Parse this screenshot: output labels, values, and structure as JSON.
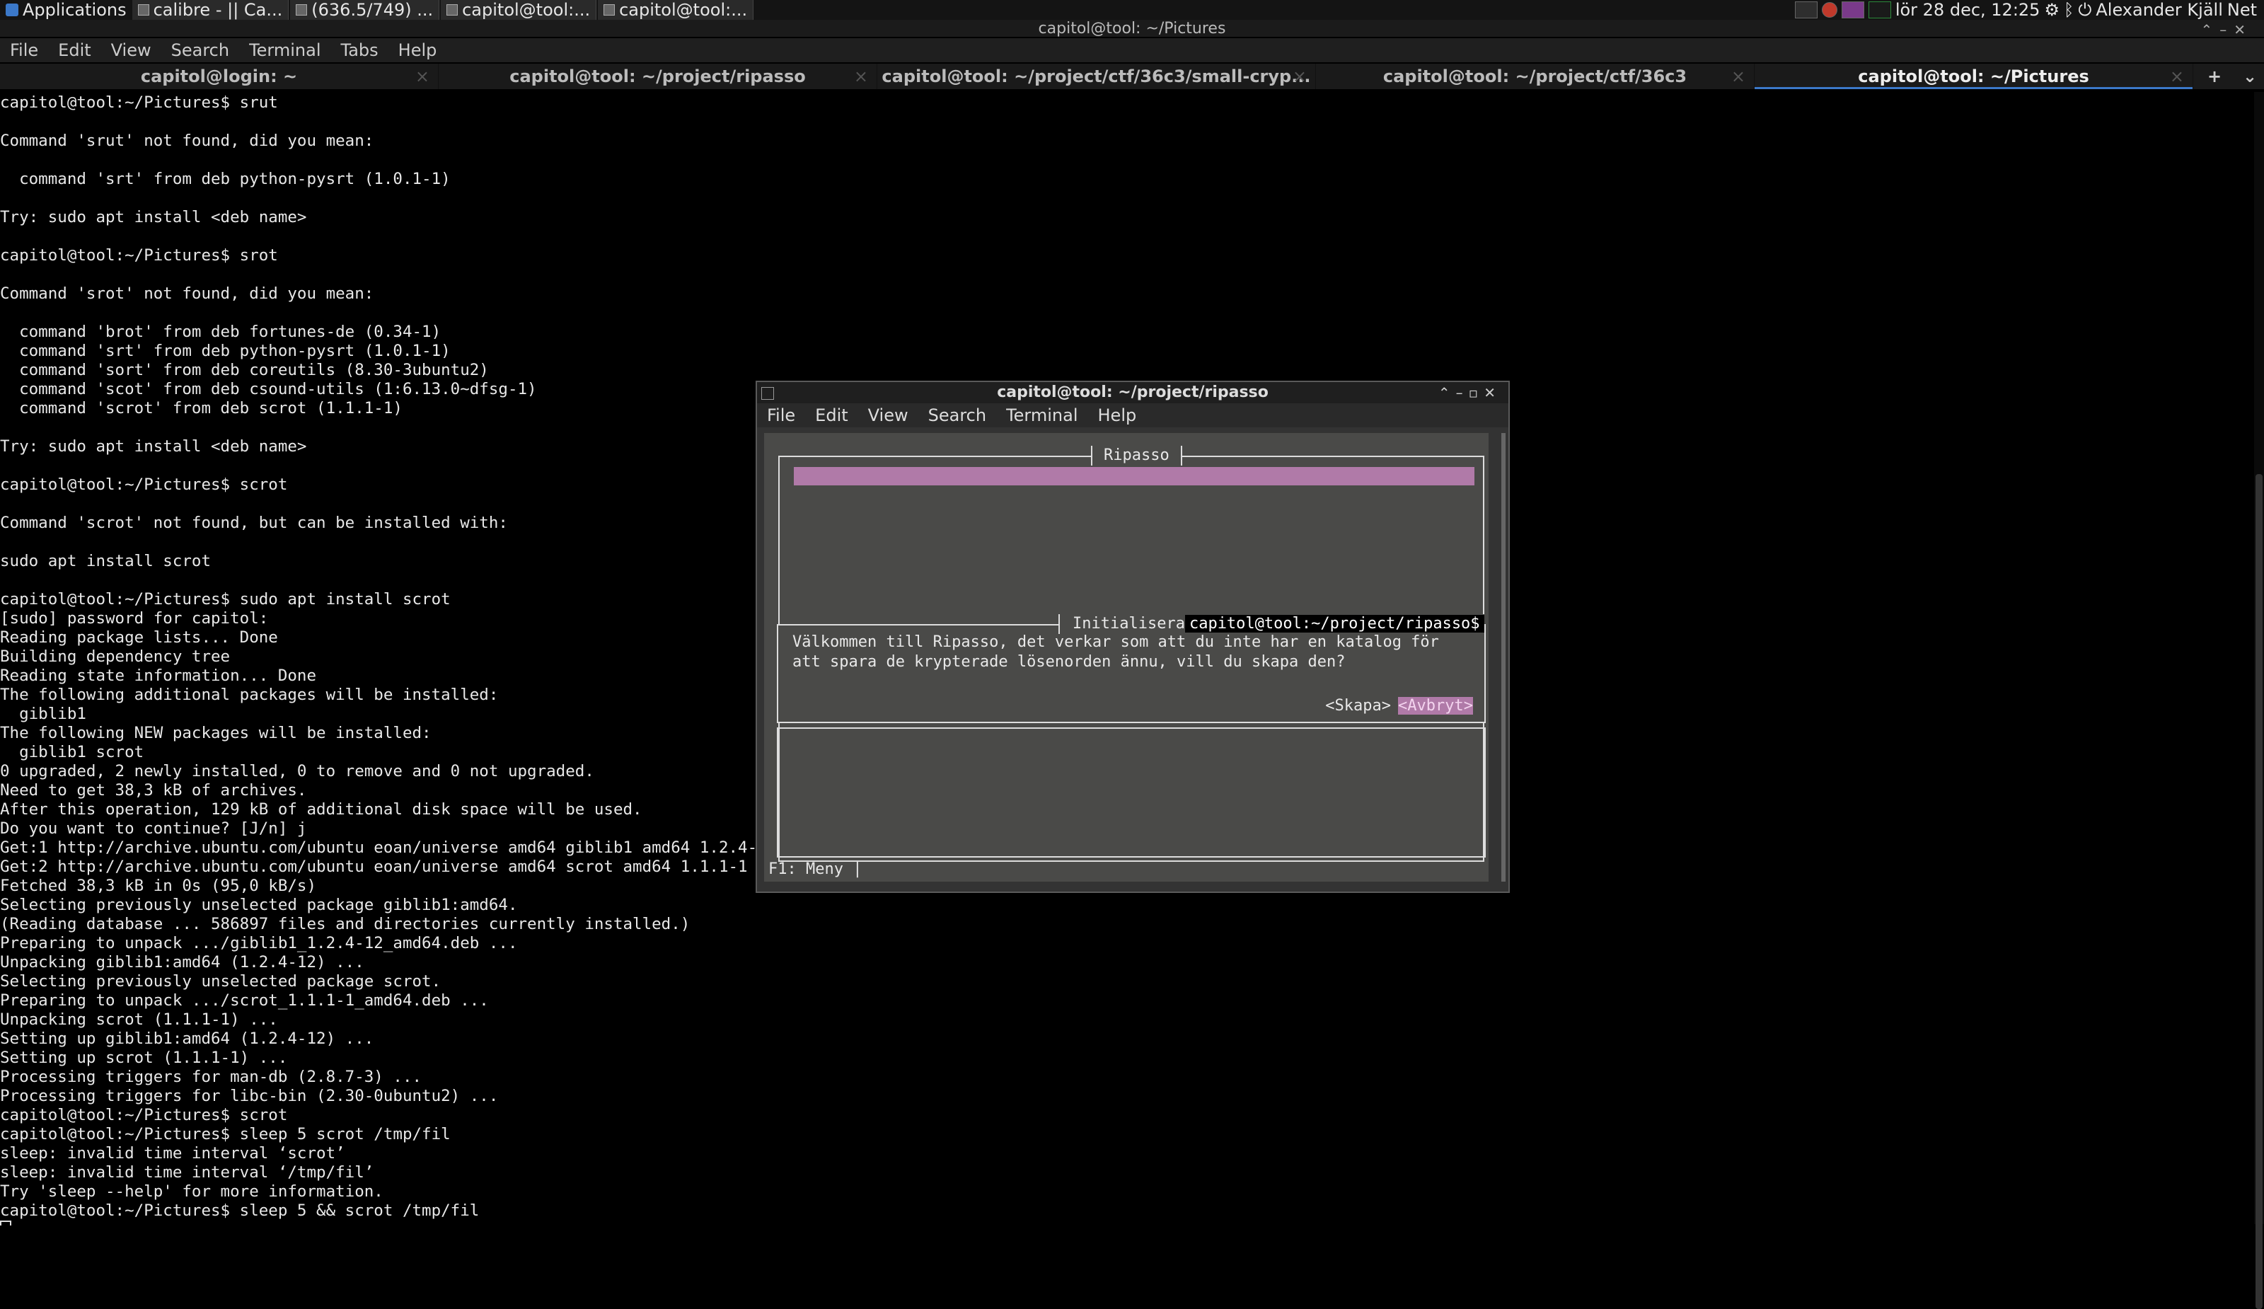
{
  "panel": {
    "applications_label": "Applications",
    "tasks": [
      "calibre - || Ca...",
      "(636.5/749) ...",
      "capitol@tool:...",
      "capitol@tool:..."
    ],
    "datetime": "lör 28 dec, 12:25",
    "user": "Alexander Kjäll",
    "network_label": "Net"
  },
  "window": {
    "title": "capitol@tool: ~/Pictures",
    "menu": [
      "File",
      "Edit",
      "View",
      "Search",
      "Terminal",
      "Tabs",
      "Help"
    ],
    "tabs": [
      {
        "label": "capitol@login: ~",
        "active": false
      },
      {
        "label": "capitol@tool: ~/project/ripasso",
        "active": false
      },
      {
        "label": "capitol@tool: ~/project/ctf/36c3/small-cryp...",
        "active": false
      },
      {
        "label": "capitol@tool: ~/project/ctf/36c3",
        "active": false
      },
      {
        "label": "capitol@tool: ~/Pictures",
        "active": true
      }
    ],
    "tab_add": "+",
    "tab_close": "×",
    "output_lines": [
      "capitol@tool:~/Pictures$ srut",
      "",
      "Command 'srut' not found, did you mean:",
      "",
      "  command 'srt' from deb python-pysrt (1.0.1-1)",
      "",
      "Try: sudo apt install <deb name>",
      "",
      "capitol@tool:~/Pictures$ srot",
      "",
      "Command 'srot' not found, did you mean:",
      "",
      "  command 'brot' from deb fortunes-de (0.34-1)",
      "  command 'srt' from deb python-pysrt (1.0.1-1)",
      "  command 'sort' from deb coreutils (8.30-3ubuntu2)",
      "  command 'scot' from deb csound-utils (1:6.13.0~dfsg-1)",
      "  command 'scrot' from deb scrot (1.1.1-1)",
      "",
      "Try: sudo apt install <deb name>",
      "",
      "capitol@tool:~/Pictures$ scrot",
      "",
      "Command 'scrot' not found, but can be installed with:",
      "",
      "sudo apt install scrot",
      "",
      "capitol@tool:~/Pictures$ sudo apt install scrot",
      "[sudo] password for capitol:",
      "Reading package lists... Done",
      "Building dependency tree",
      "Reading state information... Done",
      "The following additional packages will be installed:",
      "  giblib1",
      "The following NEW packages will be installed:",
      "  giblib1 scrot",
      "0 upgraded, 2 newly installed, 0 to remove and 0 not upgraded.",
      "Need to get 38,3 kB of archives.",
      "After this operation, 129 kB of additional disk space will be used.",
      "Do you want to continue? [J/n] j",
      "Get:1 http://archive.ubuntu.com/ubuntu eoan/universe amd64 giblib1 amd64 1.2.4-12",
      "Get:2 http://archive.ubuntu.com/ubuntu eoan/universe amd64 scrot amd64 1.1.1-1 [21",
      "Fetched 38,3 kB in 0s (95,0 kB/s)",
      "Selecting previously unselected package giblib1:amd64.",
      "(Reading database ... 586897 files and directories currently installed.)",
      "Preparing to unpack .../giblib1_1.2.4-12_amd64.deb ...",
      "Unpacking giblib1:amd64 (1.2.4-12) ...",
      "Selecting previously unselected package scrot.",
      "Preparing to unpack .../scrot_1.1.1-1_amd64.deb ...",
      "Unpacking scrot (1.1.1-1) ...",
      "Setting up giblib1:amd64 (1.2.4-12) ...",
      "Setting up scrot (1.1.1-1) ...",
      "Processing triggers for man-db (2.8.7-3) ...",
      "Processing triggers for libc-bin (2.30-0ubuntu2) ...",
      "capitol@tool:~/Pictures$ scrot",
      "capitol@tool:~/Pictures$ sleep 5 scrot /tmp/fil",
      "sleep: invalid time interval ‘scrot’",
      "sleep: invalid time interval ‘/tmp/fil’",
      "Try 'sleep --help' for more information.",
      "capitol@tool:~/Pictures$ sleep 5 && scrot /tmp/fil"
    ]
  },
  "floating": {
    "title": "capitol@tool: ~/project/ripasso",
    "menu": [
      "File",
      "Edit",
      "View",
      "Search",
      "Terminal",
      "Help"
    ],
    "ripasso_title": "Ripasso",
    "dialog_title_prefix": "Initialisera",
    "dialog_title_overlay": "capitol@tool:~/project/ripasso$",
    "dialog_text": "Välkommen till Ripasso, det verkar som att du inte har en katalog för att spara de krypterade lösenorden ännu, vill du skapa den?",
    "create_button": "<Skapa>",
    "cancel_button": "<Avbryt>",
    "status_line": "F1: Meny |"
  }
}
